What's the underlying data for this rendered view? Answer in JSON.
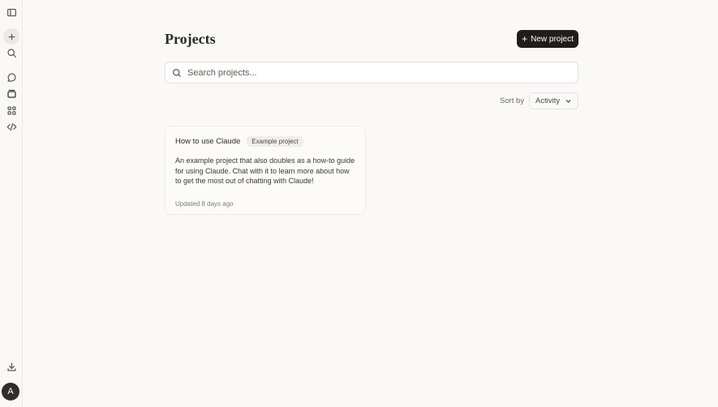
{
  "header": {
    "title": "Projects",
    "new_project_label": "New project"
  },
  "search": {
    "placeholder": "Search projects..."
  },
  "sort": {
    "label": "Sort by",
    "selected": "Activity"
  },
  "projects": [
    {
      "title": "How to use Claude",
      "badge": "Example project",
      "description": "An example project that also doubles as a how-to guide for using Claude. Chat with it to learn more about how to get the most out of chatting with Claude!",
      "updated": "Updated 8 days ago"
    }
  ],
  "sidebar": {
    "icons": [
      "sidebar-toggle-icon",
      "new-chat-icon",
      "search-icon",
      "chats-icon",
      "projects-icon",
      "artifacts-icon",
      "code-icon",
      "download-icon"
    ],
    "avatar_initial": "A"
  }
}
